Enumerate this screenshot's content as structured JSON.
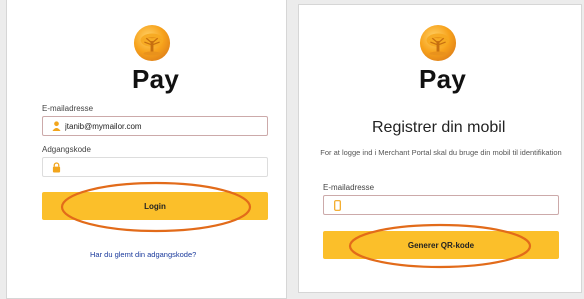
{
  "login_panel": {
    "brand": "Pay",
    "email_label": "E-mailadresse",
    "email_value": "jtanib@mymailor.com",
    "password_label": "Adgangskode",
    "login_button": "Login",
    "forgot_link": "Har du glemt din adgangskode?"
  },
  "register_panel": {
    "brand": "Pay",
    "heading": "Registrer din mobil",
    "description": "For at logge ind i Merchant Portal skal du bruge din mobil til identifikation",
    "email_label": "E-mailadresse",
    "email_value": "",
    "generate_button": "Generer QR-kode"
  },
  "colors": {
    "accent": "#fbbf2a",
    "annotation": "#e26b1a",
    "link": "#1a3a9c"
  },
  "icons": {
    "logo": "tree-coin-logo",
    "email_field": "user-icon",
    "password_field": "lock-icon",
    "register_email_field": "phone-icon"
  }
}
